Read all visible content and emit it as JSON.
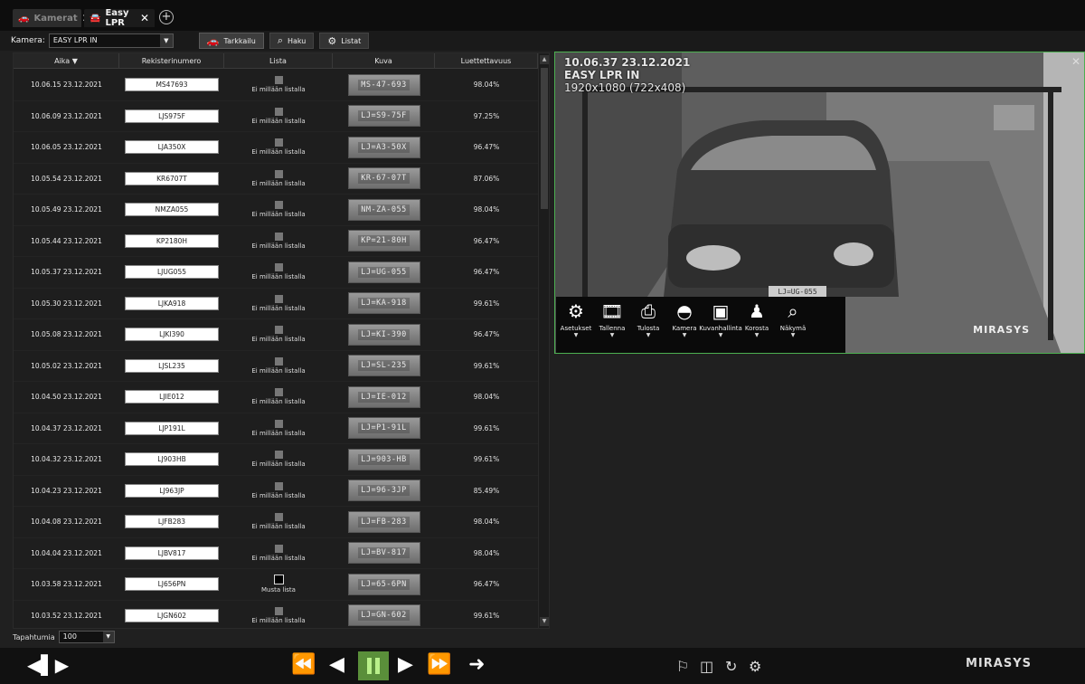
{
  "tabs": [
    {
      "label": "Kamerat",
      "close": "✕",
      "state": "inactive"
    },
    {
      "label": "Easy LPR",
      "close": "✕",
      "state": "active"
    }
  ],
  "tab_add": "+",
  "toolbar": {
    "camera_label": "Kamera:",
    "camera_value": "EASY LPR IN",
    "buttons": [
      {
        "label": "Tarkkailu",
        "icon": "car-icon"
      },
      {
        "label": "Haku",
        "icon": "search-icon"
      },
      {
        "label": "Listat",
        "icon": "gear-icon"
      }
    ]
  },
  "table": {
    "headers": {
      "aika": "Aika ▼",
      "rekisterinumero": "Rekisterinumero",
      "lista": "Lista",
      "kuva": "Kuva",
      "luettavuus": "Luettettavuus"
    },
    "rows": [
      {
        "time": "10.06.15  23.12.2021",
        "plate": "MS47693",
        "list": "Ei millään listalla",
        "img": "MS-47-693",
        "pct": "98.04%",
        "black": false
      },
      {
        "time": "10.06.09  23.12.2021",
        "plate": "LJS975F",
        "list": "Ei millään listalla",
        "img": "LJ=S9-75F",
        "pct": "97.25%",
        "black": false
      },
      {
        "time": "10.06.05  23.12.2021",
        "plate": "LJA350X",
        "list": "Ei millään listalla",
        "img": "LJ=A3-50X",
        "pct": "96.47%",
        "black": false
      },
      {
        "time": "10.05.54  23.12.2021",
        "plate": "KR6707T",
        "list": "Ei millään listalla",
        "img": "KR-67-07T",
        "pct": "87.06%",
        "black": false
      },
      {
        "time": "10.05.49  23.12.2021",
        "plate": "NMZA055",
        "list": "Ei millään listalla",
        "img": "NM-ZA-055",
        "pct": "98.04%",
        "black": false
      },
      {
        "time": "10.05.44  23.12.2021",
        "plate": "KP2180H",
        "list": "Ei millään listalla",
        "img": "KP=21-80H",
        "pct": "96.47%",
        "black": false
      },
      {
        "time": "10.05.37  23.12.2021",
        "plate": "LJUG055",
        "list": "Ei millään listalla",
        "img": "LJ=UG-055",
        "pct": "96.47%",
        "black": false
      },
      {
        "time": "10.05.30  23.12.2021",
        "plate": "LJKA918",
        "list": "Ei millään listalla",
        "img": "LJ=KA-918",
        "pct": "99.61%",
        "black": false
      },
      {
        "time": "10.05.08  23.12.2021",
        "plate": "LJKI390",
        "list": "Ei millään listalla",
        "img": "LJ=KI-390",
        "pct": "96.47%",
        "black": false
      },
      {
        "time": "10.05.02  23.12.2021",
        "plate": "LJSL235",
        "list": "Ei millään listalla",
        "img": "LJ=SL-235",
        "pct": "99.61%",
        "black": false
      },
      {
        "time": "10.04.50  23.12.2021",
        "plate": "LJIE012",
        "list": "Ei millään listalla",
        "img": "LJ=IE-012",
        "pct": "98.04%",
        "black": false
      },
      {
        "time": "10.04.37  23.12.2021",
        "plate": "LJP191L",
        "list": "Ei millään listalla",
        "img": "LJ=P1-91L",
        "pct": "99.61%",
        "black": false
      },
      {
        "time": "10.04.32  23.12.2021",
        "plate": "LJ903HB",
        "list": "Ei millään listalla",
        "img": "LJ=903-HB",
        "pct": "99.61%",
        "black": false
      },
      {
        "time": "10.04.23  23.12.2021",
        "plate": "LJ963JP",
        "list": "Ei millään listalla",
        "img": "LJ=96-3JP",
        "pct": "85.49%",
        "black": false
      },
      {
        "time": "10.04.08  23.12.2021",
        "plate": "LJFB283",
        "list": "Ei millään listalla",
        "img": "LJ=FB-283",
        "pct": "98.04%",
        "black": false
      },
      {
        "time": "10.04.04  23.12.2021",
        "plate": "LJBV817",
        "list": "Ei millään listalla",
        "img": "LJ=BV-817",
        "pct": "98.04%",
        "black": false
      },
      {
        "time": "10.03.58  23.12.2021",
        "plate": "LJ656PN",
        "list": "Musta lista",
        "img": "LJ=65-6PN",
        "pct": "96.47%",
        "black": true
      },
      {
        "time": "10.03.52  23.12.2021",
        "plate": "LJGN602",
        "list": "Ei millään listalla",
        "img": "LJ=GN-602",
        "pct": "99.61%",
        "black": false
      }
    ]
  },
  "events": {
    "label": "Tapahtumia",
    "value": "100"
  },
  "video": {
    "timestamp": "10.06.37  23.12.2021",
    "camera_name": "EASY LPR IN",
    "resolution": "1920x1080 (722x408)",
    "plate_overlay": "LJ=UG-055",
    "logo": "MIRASYS",
    "close": "✕"
  },
  "video_toolbar": [
    {
      "label": "Asetukset",
      "icon": "gear-icon",
      "glyph": "⚙"
    },
    {
      "label": "Tallenna",
      "icon": "film-icon",
      "glyph": "🎞"
    },
    {
      "label": "Tulosta",
      "icon": "printer-icon",
      "glyph": "⎙"
    },
    {
      "label": "Kamera",
      "icon": "dome-camera-icon",
      "glyph": "◓"
    },
    {
      "label": "Kuvanhallinta",
      "icon": "image-adjust-icon",
      "glyph": "▣"
    },
    {
      "label": "Korosta",
      "icon": "person-icon",
      "glyph": "♟"
    },
    {
      "label": "Näkymä",
      "icon": "zoom-view-icon",
      "glyph": "⌕"
    }
  ],
  "playbar": {
    "brand": "MIRASYS"
  }
}
